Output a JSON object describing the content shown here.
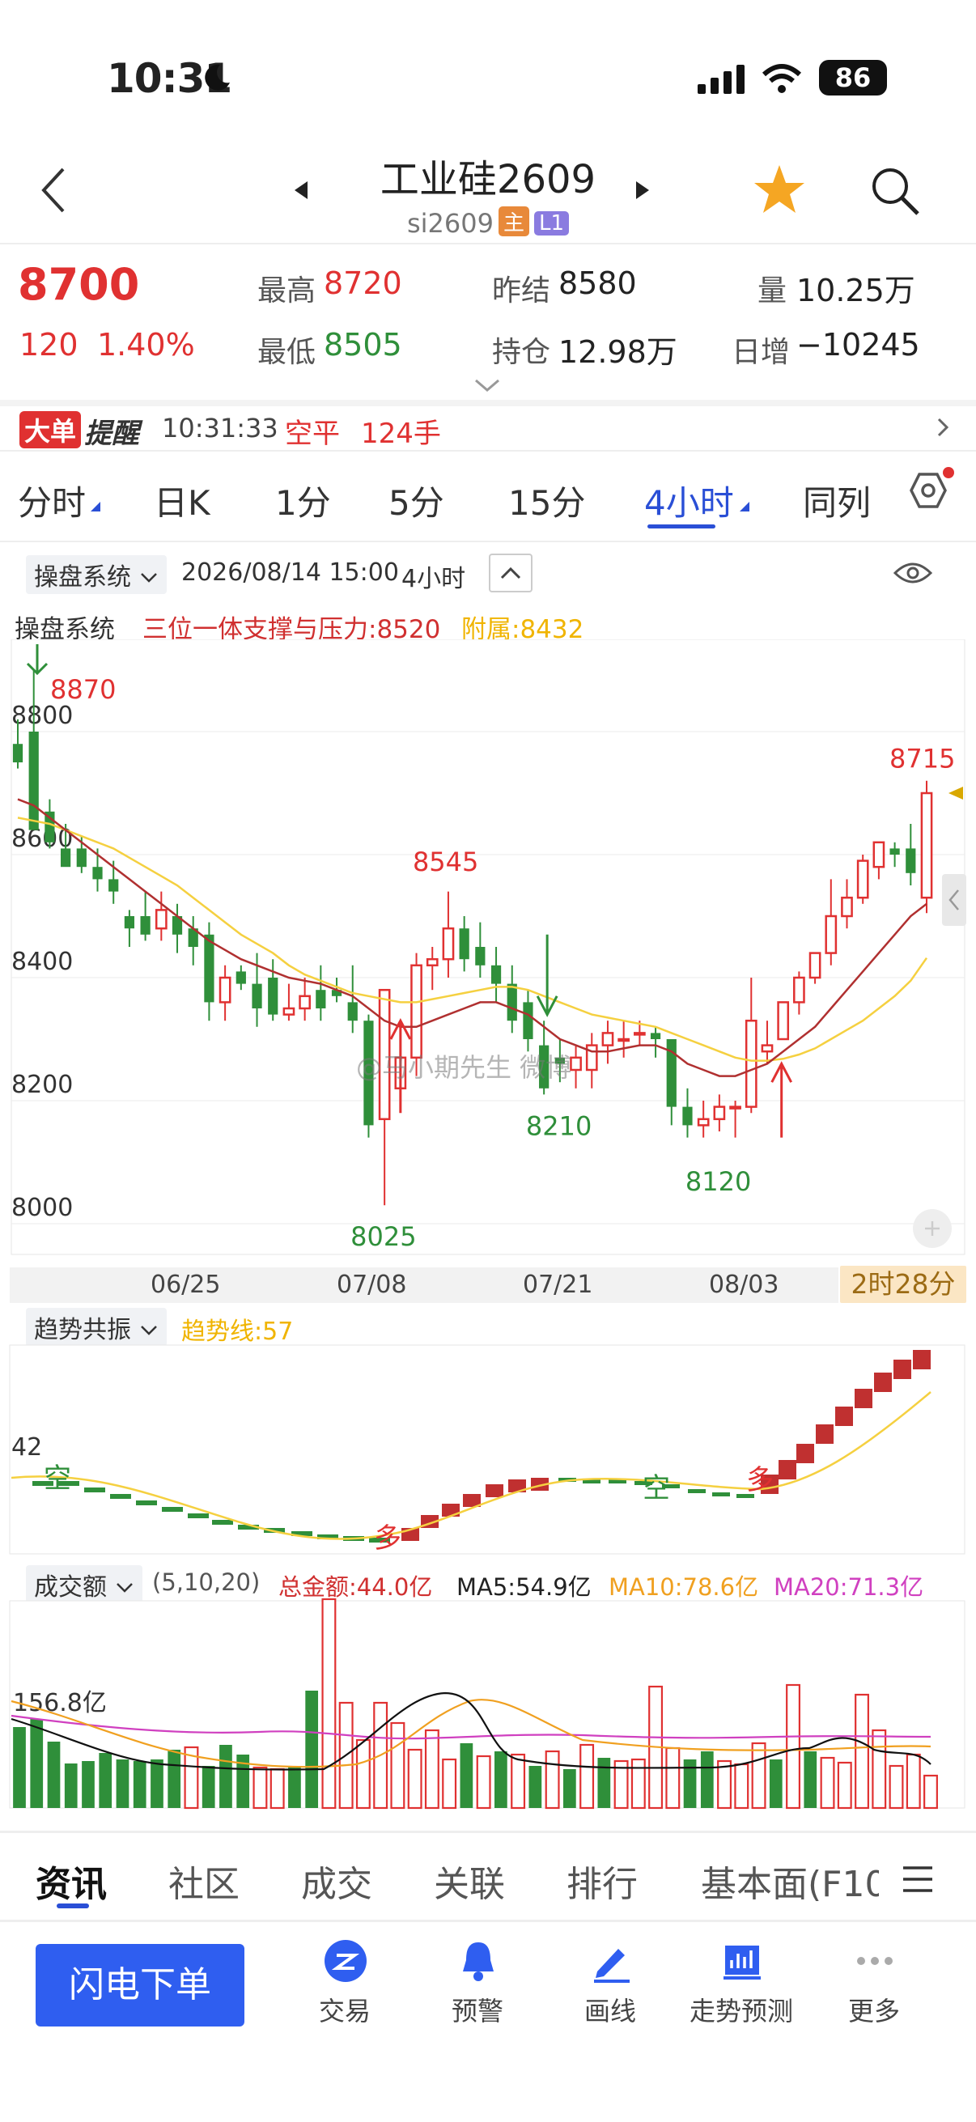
{
  "status": {
    "time": "10:31",
    "battery": "86"
  },
  "nav": {
    "title": "工业硅2609",
    "code": "si2609",
    "badge_main": "主",
    "badge_level": "L1"
  },
  "quote": {
    "price": "8700",
    "change": "120",
    "change_pct": "1.40%",
    "high_label": "最高",
    "high": "8720",
    "low_label": "最低",
    "low": "8505",
    "prev_settle_label": "昨结",
    "prev_settle": "8580",
    "open_interest_label": "持仓",
    "open_interest": "12.98万",
    "volume_label": "量",
    "volume": "10.25万",
    "daily_add_label": "日增",
    "daily_add": "−10245"
  },
  "alert": {
    "badge": "大单",
    "label": "提醒",
    "time": "10:31:33",
    "type": "空平",
    "lots": "124手"
  },
  "period_tabs": [
    "分时",
    "日K",
    "1分",
    "5分",
    "15分",
    "4小时",
    "同列"
  ],
  "active_tab": "4小时",
  "chart_header": {
    "system": "操盘系统",
    "datetime": "2026/08/14 15:00",
    "period": "4小时"
  },
  "indicator_line": {
    "name": "操盘系统",
    "support_label": "三位一体支撑与压力:8520",
    "attach_label": "附属:8432"
  },
  "watermark": "@马小期先生 微博",
  "countdown": "2时28分",
  "trend_panel": {
    "name": "趋势共振",
    "trend_line": "趋势线:57",
    "level": "42",
    "markers": [
      "空",
      "多",
      "空",
      "多"
    ]
  },
  "volume_panel": {
    "name": "成交额",
    "params": "(5,10,20)",
    "total": "总金额:44.0亿",
    "ma5": "MA5:54.9亿",
    "ma10": "MA10:78.6亿",
    "ma20": "MA20:71.3亿",
    "level": "156.8亿"
  },
  "bottom_tabs": [
    "资讯",
    "社区",
    "成交",
    "关联",
    "排行",
    "基本面(F10"
  ],
  "bottom_nav": {
    "order_button": "闪电下单",
    "items": [
      "交易",
      "预警",
      "画线",
      "走势预测",
      "更多"
    ]
  },
  "colors": {
    "up": "#e03131",
    "down": "#2f8f3a",
    "ma_red": "#b03030",
    "ma_yellow": "#f5d040",
    "accent_blue": "#2f5ef0",
    "tab_active": "#2a4fd6"
  },
  "chart_data": {
    "type": "candlestick",
    "ylim": [
      7950,
      8950
    ],
    "y_ticks": [
      8000,
      8200,
      8400,
      8600,
      8800
    ],
    "x_ticks": [
      "06/25",
      "07/08",
      "07/21",
      "08/03"
    ],
    "annotations": [
      "8870",
      "8545",
      "8025",
      "8210",
      "8120",
      "8715"
    ],
    "candles": [
      [
        8780,
        8820,
        8750,
        8740
      ],
      [
        8800,
        8900,
        8640,
        8680
      ],
      [
        8670,
        8690,
        8620,
        8610
      ],
      [
        8610,
        8650,
        8580,
        8600
      ],
      [
        8610,
        8630,
        8580,
        8570
      ],
      [
        8580,
        8610,
        8560,
        8540
      ],
      [
        8560,
        8590,
        8540,
        8520
      ],
      [
        8500,
        8510,
        8480,
        8450
      ],
      [
        8500,
        8540,
        8470,
        8460
      ],
      [
        8480,
        8540,
        8510,
        8460
      ],
      [
        8500,
        8520,
        8470,
        8440
      ],
      [
        8480,
        8500,
        8450,
        8420
      ],
      [
        8470,
        8490,
        8360,
        8330
      ],
      [
        8360,
        8420,
        8400,
        8330
      ],
      [
        8410,
        8420,
        8390,
        8380
      ],
      [
        8390,
        8440,
        8350,
        8320
      ],
      [
        8400,
        8430,
        8340,
        8330
      ],
      [
        8340,
        8390,
        8350,
        8330
      ],
      [
        8350,
        8400,
        8370,
        8330
      ],
      [
        8380,
        8420,
        8350,
        8330
      ],
      [
        8380,
        8400,
        8370,
        8360
      ],
      [
        8360,
        8420,
        8330,
        8310
      ],
      [
        8330,
        8340,
        8160,
        8140
      ],
      [
        8170,
        8280,
        8380,
        8030
      ],
      [
        8220,
        8300,
        8270,
        8200
      ],
      [
        8270,
        8440,
        8420,
        8240
      ],
      [
        8420,
        8450,
        8430,
        8380
      ],
      [
        8430,
        8540,
        8480,
        8400
      ],
      [
        8480,
        8500,
        8430,
        8410
      ],
      [
        8450,
        8490,
        8420,
        8400
      ],
      [
        8420,
        8450,
        8390,
        8360
      ],
      [
        8390,
        8420,
        8330,
        8310
      ],
      [
        8360,
        8380,
        8300,
        8280
      ],
      [
        8290,
        8330,
        8220,
        8210
      ],
      [
        8270,
        8300,
        8260,
        8230
      ],
      [
        8250,
        8290,
        8270,
        8220
      ],
      [
        8250,
        8310,
        8290,
        8220
      ],
      [
        8290,
        8330,
        8310,
        8260
      ],
      [
        8300,
        8330,
        8300,
        8270
      ],
      [
        8310,
        8330,
        8310,
        8290
      ],
      [
        8310,
        8320,
        8300,
        8270
      ],
      [
        8300,
        8300,
        8190,
        8160
      ],
      [
        8190,
        8220,
        8160,
        8140
      ],
      [
        8160,
        8200,
        8170,
        8140
      ],
      [
        8170,
        8210,
        8190,
        8150
      ],
      [
        8190,
        8200,
        8190,
        8140
      ],
      [
        8190,
        8400,
        8330,
        8180
      ],
      [
        8280,
        8330,
        8290,
        8260
      ],
      [
        8300,
        8340,
        8360,
        8300
      ],
      [
        8360,
        8410,
        8400,
        8340
      ],
      [
        8400,
        8430,
        8440,
        8390
      ],
      [
        8440,
        8560,
        8500,
        8420
      ],
      [
        8500,
        8560,
        8530,
        8480
      ],
      [
        8530,
        8600,
        8590,
        8520
      ],
      [
        8580,
        8620,
        8620,
        8560
      ],
      [
        8610,
        8620,
        8600,
        8580
      ],
      [
        8610,
        8650,
        8570,
        8550
      ],
      [
        8530,
        8720,
        8700,
        8505
      ]
    ],
    "ma_red": [
      8690,
      8680,
      8660,
      8640,
      8620,
      8600,
      8580,
      8560,
      8540,
      8520,
      8500,
      8480,
      8460,
      8445,
      8430,
      8420,
      8410,
      8400,
      8395,
      8390,
      8380,
      8370,
      8350,
      8330,
      8320,
      8320,
      8330,
      8340,
      8350,
      8360,
      8360,
      8350,
      8340,
      8320,
      8300,
      8290,
      8280,
      8280,
      8285,
      8290,
      8290,
      8280,
      8260,
      8250,
      8240,
      8240,
      8250,
      8260,
      8280,
      8300,
      8320,
      8350,
      8380,
      8410,
      8440,
      8470,
      8500,
      8520
    ],
    "ma_yellow": [
      8660,
      8655,
      8650,
      8640,
      8630,
      8620,
      8610,
      8595,
      8580,
      8565,
      8550,
      8530,
      8510,
      8490,
      8470,
      8455,
      8440,
      8420,
      8405,
      8395,
      8385,
      8375,
      8370,
      8365,
      8360,
      8360,
      8365,
      8370,
      8375,
      8380,
      8385,
      8385,
      8380,
      8370,
      8360,
      8350,
      8340,
      8335,
      8330,
      8325,
      8320,
      8310,
      8300,
      8290,
      8280,
      8270,
      8265,
      8265,
      8268,
      8275,
      8285,
      8300,
      8315,
      8330,
      8350,
      8370,
      8395,
      8432
    ]
  }
}
